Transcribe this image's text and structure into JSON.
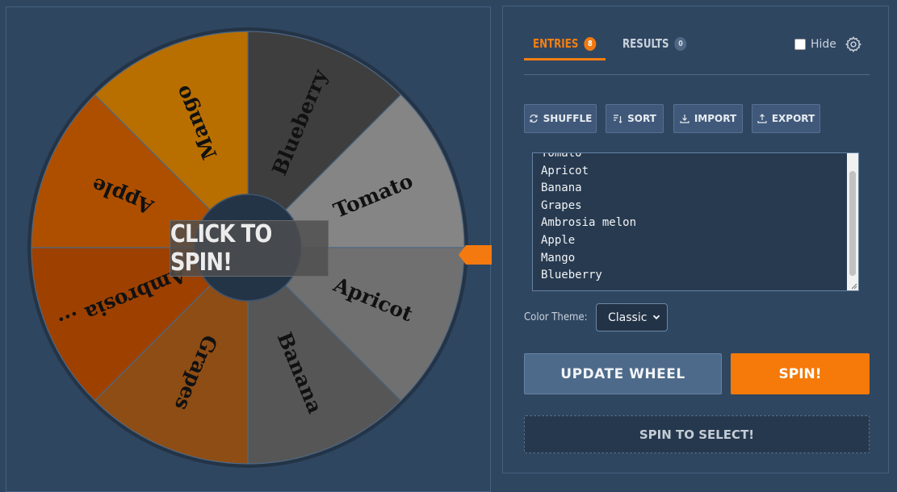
{
  "wheel": {
    "center_button_label": "CLICK TO SPIN!",
    "segments": [
      {
        "label": "Blueberry",
        "color": "#3e3e3e"
      },
      {
        "label": "Tomato",
        "color": "#858585"
      },
      {
        "label": "Apricot",
        "color": "#707070"
      },
      {
        "label": "Banana",
        "color": "#565656"
      },
      {
        "label": "Grapes",
        "color": "#8e4d14"
      },
      {
        "label": "Ambrosia ...",
        "color": "#9d4000"
      },
      {
        "label": "Apple",
        "color": "#ae4f00"
      },
      {
        "label": "Mango",
        "color": "#b86f00"
      }
    ],
    "pointer_color": "#f47a10"
  },
  "tabs": {
    "entries_label": "ENTRIES",
    "entries_count": "8",
    "results_label": "RESULTS",
    "results_count": "0"
  },
  "hide_label": "Hide",
  "toolbar": {
    "shuffle": "SHUFFLE",
    "sort": "SORT",
    "import": "IMPORT",
    "export": "EXPORT"
  },
  "entries_text": "Tomato\nApricot\nBanana\nGrapes\nAmbrosia melon\nApple\nMango\nBlueberry",
  "color_theme": {
    "label": "Color Theme:",
    "selected": "Classic"
  },
  "buttons": {
    "update_wheel": "UPDATE WHEEL",
    "spin": "SPIN!",
    "spin_to_select": "SPIN TO SELECT!"
  }
}
